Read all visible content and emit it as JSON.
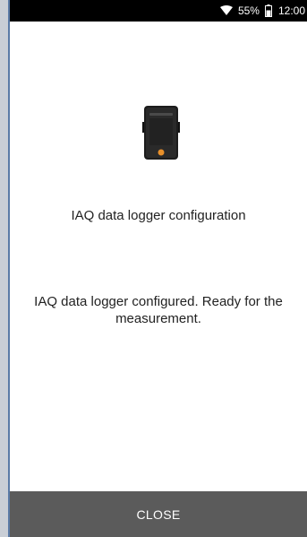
{
  "status_bar": {
    "battery_percent": "55%",
    "time": "12:00",
    "icons": [
      "wifi-icon",
      "battery-icon"
    ]
  },
  "dialog": {
    "image_icon": "iaq-data-logger-device-icon",
    "title": "IAQ data logger configuration",
    "message": "IAQ data logger configured. Ready for the measurement.",
    "close_label": "CLOSE"
  },
  "colors": {
    "status_bar_bg": "#000000",
    "background": "#ffffff",
    "close_bar_bg": "#5b5b5b",
    "text": "#222222"
  }
}
